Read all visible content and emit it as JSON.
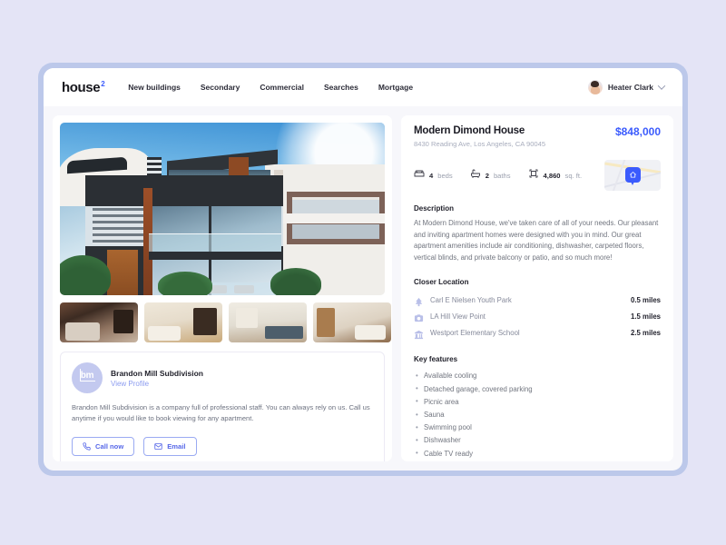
{
  "brand": {
    "name": "house",
    "sup": "2"
  },
  "nav": {
    "items": [
      {
        "label": "New buildings"
      },
      {
        "label": "Secondary"
      },
      {
        "label": "Commercial"
      },
      {
        "label": "Searches"
      },
      {
        "label": "Mortgage"
      }
    ]
  },
  "user": {
    "name": "Heater Clark",
    "avatar_icon": "user-avatar",
    "chevron_icon": "chevron-down-icon"
  },
  "gallery": {
    "hero_alt": "modern-white-house-exterior",
    "thumbnails": [
      {
        "alt": "living-room-interior"
      },
      {
        "alt": "bedroom-interior"
      },
      {
        "alt": "kitchen-interior"
      },
      {
        "alt": "bedroom-with-shelving"
      }
    ]
  },
  "agent": {
    "logo_text": "bm",
    "name": "Brandon Mill Subdivision",
    "profile_link": "View Profile",
    "description": "Brandon Mill Subdivision is a company full of professional staff. You can always rely on us. Call us anytime if you would like to book viewing for any apartment.",
    "call_label": "Call now",
    "email_label": "Email",
    "call_icon": "phone-icon",
    "email_icon": "envelope-icon"
  },
  "property": {
    "title": "Modern Dimond House",
    "address": "8430 Reading Ave, Los Angeles, CA 90045",
    "price": "$848,000",
    "map_icon": "map-pin-house-icon",
    "specs": [
      {
        "icon": "bed-icon",
        "value": "4",
        "unit": "beds"
      },
      {
        "icon": "bathtub-icon",
        "value": "2",
        "unit": "baths"
      },
      {
        "icon": "area-icon",
        "value": "4,860",
        "unit": "sq. ft."
      }
    ]
  },
  "description": {
    "heading": "Description",
    "text": "At Modern Dimond House, we've taken care of all of your needs. Our pleasant and inviting apartment homes were designed with you in mind. Our great apartment amenities include air conditioning, dishwasher, carpeted floors, vertical blinds, and private balcony or patio, and so much more!"
  },
  "closer_location": {
    "heading": "Closer Location",
    "items": [
      {
        "icon": "tree-icon",
        "name": "Carl E Nielsen Youth Park",
        "distance": "0.5 miles"
      },
      {
        "icon": "camera-icon",
        "name": "LA Hill View Point",
        "distance": "1.5 miles"
      },
      {
        "icon": "school-icon",
        "name": "Westport Elementary School",
        "distance": "2.5 miles"
      }
    ]
  },
  "key_features": {
    "heading": "Key features",
    "items": [
      {
        "label": "Available cooling"
      },
      {
        "label": "Detached garage, covered parking"
      },
      {
        "label": "Picnic area"
      },
      {
        "label": "Sauna"
      },
      {
        "label": "Swimming pool"
      },
      {
        "label": "Dishwasher"
      },
      {
        "label": "Cable TV ready"
      }
    ]
  },
  "colors": {
    "page_background": "#e4e4f6",
    "window_frame": "#bcc8ea",
    "content_background": "#f7f7fb",
    "card": "#ffffff",
    "accent_blue": "#3b5bfd",
    "link_periwinkle": "#8c9cf0",
    "muted_text": "#71757f",
    "icon_lavender": "#b9bfe8"
  }
}
